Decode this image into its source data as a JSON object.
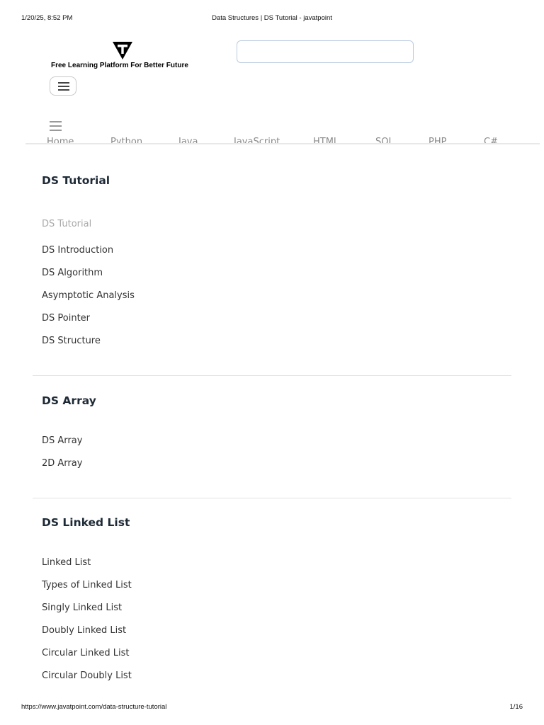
{
  "print_header": {
    "datetime": "1/20/25, 8:52 PM",
    "title": "Data Structures | DS Tutorial - javatpoint"
  },
  "print_footer": {
    "url": "https://www.javatpoint.com/data-structure-tutorial",
    "page": "1/16"
  },
  "header": {
    "tagline": "Free Learning Platform For Better Future",
    "search": {
      "value": "",
      "placeholder": ""
    },
    "logo_icon": "javatpoint-t-logo",
    "menu_icon": "hamburger-icon"
  },
  "nav": {
    "items": [
      "Home",
      "Python",
      "Java",
      "JavaScript",
      "HTML",
      "SQL",
      "PHP",
      "C#"
    ]
  },
  "sections": [
    {
      "title": "DS Tutorial",
      "links": [
        "DS Tutorial",
        "DS Introduction",
        "DS Algorithm",
        "Asymptotic Analysis",
        "DS Pointer",
        "DS Structure"
      ],
      "active_index": 0
    },
    {
      "title": "DS Array",
      "links": [
        "DS Array",
        "2D Array"
      ]
    },
    {
      "title": "DS Linked List",
      "links": [
        "Linked List",
        "Types of Linked List",
        "Singly Linked List",
        "Doubly Linked List",
        "Circular Linked List",
        "Circular Doubly List"
      ]
    }
  ],
  "colors": {
    "heading": "#1e2a36",
    "link": "#333333",
    "active_link": "#a9a9a9",
    "divider": "#e2e2e2"
  }
}
